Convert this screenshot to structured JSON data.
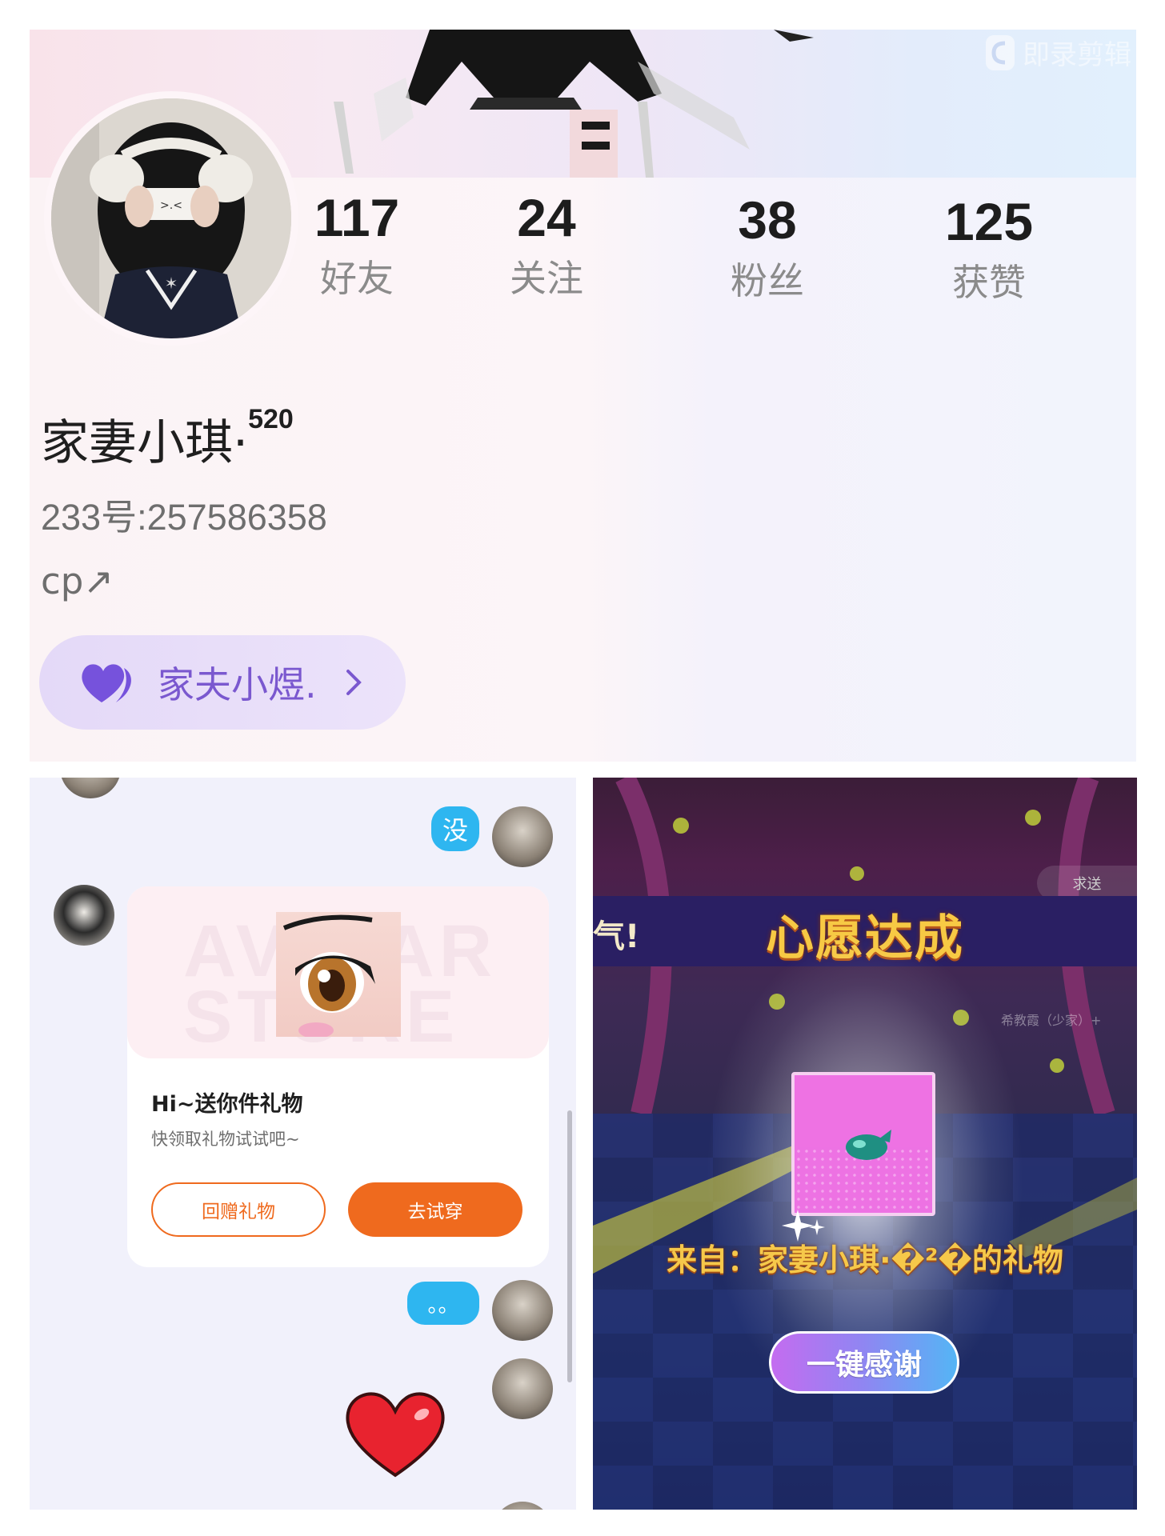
{
  "profile": {
    "watermark": "即录剪辑",
    "stats": [
      {
        "value": "117",
        "label": "好友"
      },
      {
        "value": "24",
        "label": "关注"
      },
      {
        "value": "38",
        "label": "粉丝"
      },
      {
        "value": "125",
        "label": "获赞"
      }
    ],
    "username": "家妻小琪·",
    "username_suffix": "520",
    "user_id": "233号:257586358",
    "bio": "cp↗",
    "cp_name": "家夫小煜."
  },
  "chat": {
    "msg1": "没",
    "card_title": "Hi~送你件礼物",
    "card_subtitle": "快领取礼物试试吧~",
    "card_bg_text": "AVATAR STORE",
    "btn_return": "回赠礼物",
    "btn_try": "去试穿",
    "msg2": "。。"
  },
  "wish": {
    "band_partial": "气!",
    "title": "心愿达成",
    "request_label": "求送",
    "bg_label": "希教霞（少家）+",
    "from_text": "来自：家妻小琪·�²�的礼物",
    "thanks_button": "一键感谢"
  },
  "colors": {
    "accent_orange": "#ef6a1e",
    "chat_blue": "#2eb6f0",
    "cp_purple": "#7a58cf",
    "wish_gold": "#f7c944"
  }
}
